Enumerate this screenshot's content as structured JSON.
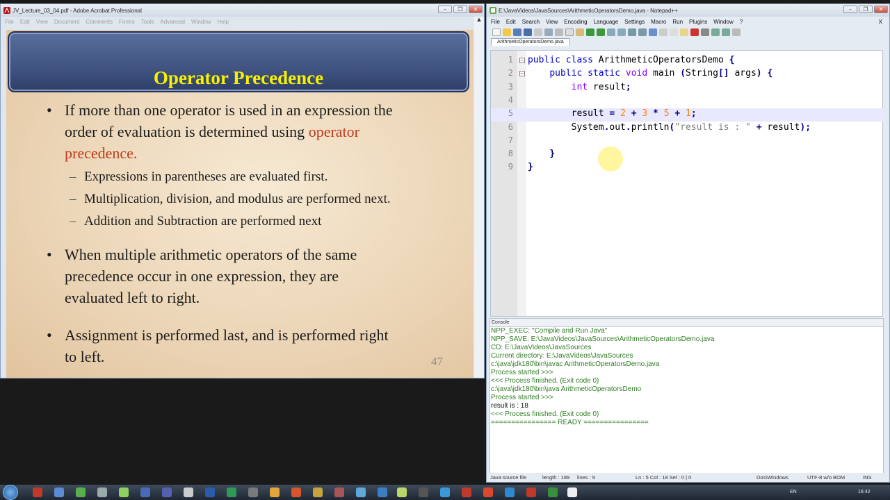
{
  "acrobat": {
    "title": "JV_Lecture_03_04.pdf - Adobe Acrobat Professional",
    "menu": [
      "File",
      "Edit",
      "View",
      "Document",
      "Comments",
      "Forms",
      "Tools",
      "Advanced",
      "Window",
      "Help"
    ],
    "slide": {
      "title": "Operator Precedence",
      "bullet1_a": "If more than one operator is used in an expression the",
      "bullet1_b": "order of evaluation is determined using ",
      "bullet1_red1": "operator",
      "bullet1_red2": "precedence.",
      "sub1": "Expressions in parentheses are evaluated first.",
      "sub2": "Multiplication, division, and modulus are performed next.",
      "sub3": "Addition and Subtraction are performed next",
      "bullet2_a": "When multiple arithmetic operators of the same",
      "bullet2_b": "precedence occur in one expression, they are",
      "bullet2_c": "evaluated left to right.",
      "bullet3_a": "Assignment is performed last, and is performed right",
      "bullet3_b": "to left.",
      "page_number": "47"
    }
  },
  "npp": {
    "title": "E:\\JavaVideos\\JavaSources\\ArithmeticOperatorsDemo.java - Notepad++",
    "menu": [
      "File",
      "Edit",
      "Search",
      "View",
      "Encoding",
      "Language",
      "Settings",
      "Macro",
      "Run",
      "Plugins",
      "Window",
      "?"
    ],
    "close_x": "X",
    "tab": "ArithmeticOperatorsDemo.java",
    "console_title": "Console",
    "console_lines": [
      "NPP_EXEC: \"Compile and Run Java\"",
      "NPP_SAVE: E:\\JavaVideos\\JavaSources\\ArithmeticOperatorsDemo.java",
      "CD: E:\\JavaVideos\\JavaSources",
      "Current directory: E:\\JavaVideos\\JavaSources",
      "c:\\java\\jdk180\\bin\\javac ArithmeticOperatorsDemo.java",
      "Process started >>>",
      "<<< Process finished. (Exit code 0)",
      "c:\\java\\jdk180\\bin\\java ArithmeticOperatorsDemo",
      "Process started >>>",
      "result is : 18",
      "<<< Process finished. (Exit code 0)",
      "================ READY ================"
    ],
    "status": {
      "type": "Java source file",
      "length": "length : 189",
      "lines": "lines : 9",
      "pos": "Ln : 5    Col : 18    Sel : 0 | 0",
      "eol": "Dos\\Windows",
      "encoding": "UTF-8 w/o BOM",
      "mode": "INS"
    }
  },
  "code": {
    "line_numbers": [
      "1",
      "2",
      "3",
      "4",
      "5",
      "6",
      "7",
      "8",
      "9"
    ]
  },
  "taskbar": {
    "lang": "EN",
    "time": "16:42"
  }
}
